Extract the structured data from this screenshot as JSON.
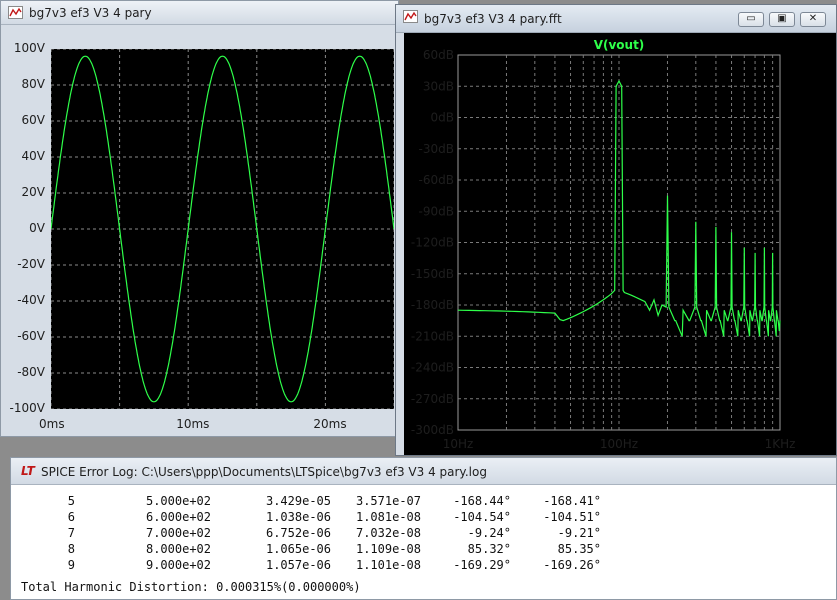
{
  "time_window": {
    "title": "bg7v3 ef3 V3 4 pary",
    "chart_data": {
      "type": "line",
      "xlim": [
        0,
        25
      ],
      "ylim": [
        -100,
        100
      ],
      "grid": true,
      "background": "#000000",
      "trace_color": "#2eff4a",
      "y_ticks": [
        "100V",
        "80V",
        "60V",
        "40V",
        "20V",
        "0V",
        "-20V",
        "-40V",
        "-60V",
        "-80V",
        "-100V"
      ],
      "x_ticks": [
        "0ms",
        "10ms",
        "20ms"
      ],
      "series": [
        {
          "amplitude": 96,
          "frequency_hz": 100,
          "x_unit": "ms",
          "y_unit": "V"
        }
      ]
    }
  },
  "fft_window": {
    "title": "bg7v3 ef3 V3 4 pary.fft",
    "controls": {
      "minimize": "▭",
      "restore": "▣",
      "close": "✕"
    },
    "chart_data": {
      "type": "line",
      "title": "V(vout)",
      "x_scale": "log",
      "xlim": [
        10,
        1000
      ],
      "ylim": [
        -300,
        60
      ],
      "grid": true,
      "background": "#000000",
      "trace_color": "#2eff4a",
      "title_color": "#2eff4a",
      "x_ticks": [
        "10Hz",
        "100Hz",
        "1KHz"
      ],
      "y_ticks": [
        "60dB",
        "30dB",
        "0dB",
        "-30dB",
        "-60dB",
        "-90dB",
        "-120dB",
        "-150dB",
        "-180dB",
        "-210dB",
        "-240dB",
        "-270dB",
        "-300dB"
      ],
      "harmonics": [
        {
          "f": 100,
          "db": 35
        },
        {
          "f": 200,
          "db": -75
        },
        {
          "f": 300,
          "db": -100
        },
        {
          "f": 400,
          "db": -105
        },
        {
          "f": 500,
          "db": -110
        },
        {
          "f": 600,
          "db": -125
        },
        {
          "f": 700,
          "db": -130
        },
        {
          "f": 800,
          "db": -125
        },
        {
          "f": 900,
          "db": -130
        }
      ],
      "floor_db": -185
    }
  },
  "log_window": {
    "logo": "LT",
    "title": "SPICE Error Log: C:\\Users\\ppp\\Documents\\LTSpice\\bg7v3 ef3 V3 4 pary.log",
    "rows": [
      [
        "5",
        "5.000e+02",
        "3.429e-05",
        "3.571e-07",
        "-168.44°",
        "-168.41°"
      ],
      [
        "6",
        "6.000e+02",
        "1.038e-06",
        "1.081e-08",
        "-104.54°",
        "-104.51°"
      ],
      [
        "7",
        "7.000e+02",
        "6.752e-06",
        "7.032e-08",
        "-9.24°",
        "-9.21°"
      ],
      [
        "8",
        "8.000e+02",
        "1.065e-06",
        "1.109e-08",
        "85.32°",
        "85.35°"
      ],
      [
        "9",
        "9.000e+02",
        "1.057e-06",
        "1.101e-08",
        "-169.29°",
        "-169.26°"
      ]
    ],
    "thd": "Total Harmonic Distortion: 0.000315%(0.000000%)"
  }
}
